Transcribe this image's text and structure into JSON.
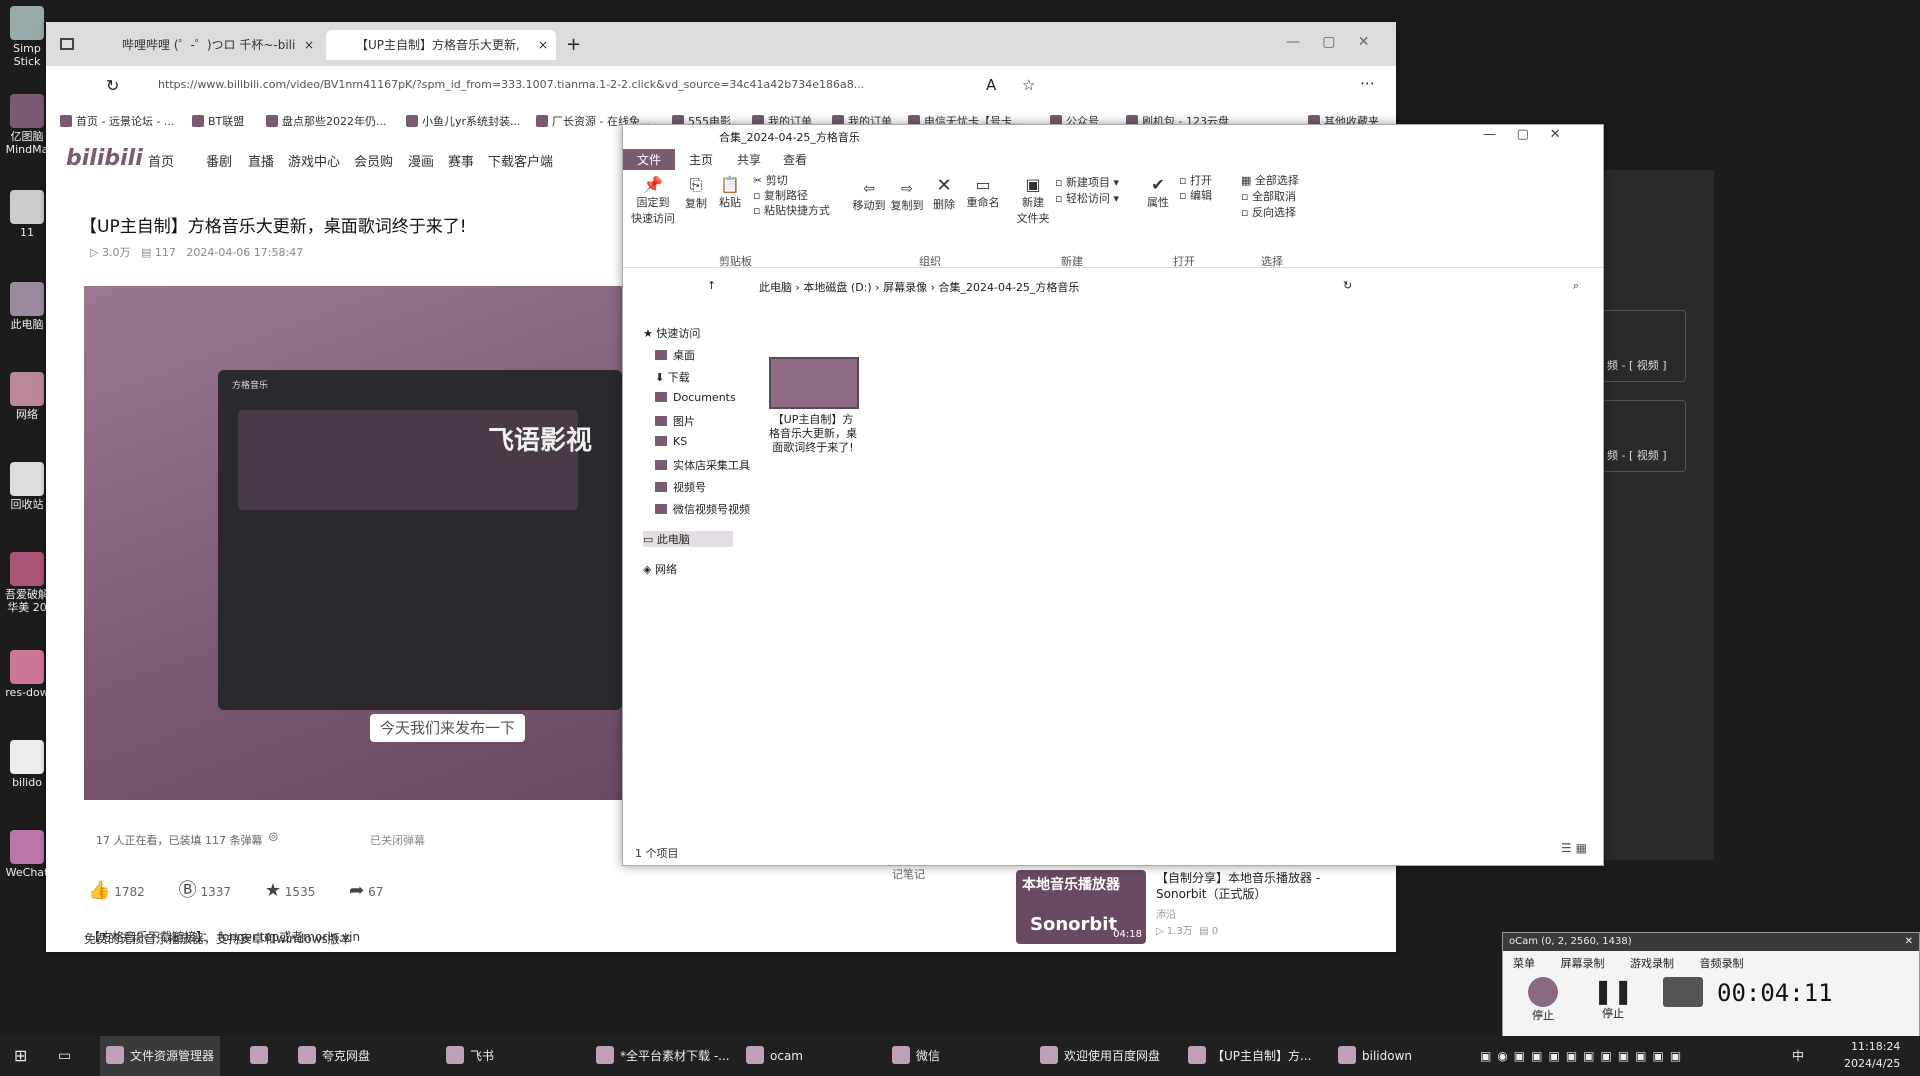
{
  "desktop": {
    "icons": [
      "Simp Stick",
      "亿图脑 MindMa",
      "11",
      "此电脑",
      "网络",
      "回收站",
      "吾爱破解 华美 20",
      "res-dow",
      "bilido",
      "WeChat"
    ]
  },
  "browser": {
    "tabs": [
      {
        "label": "哔哩哔哩 (゜-゜)つロ 千杯~-bili"
      },
      {
        "label": "【UP主自制】方格音乐大更新,"
      }
    ],
    "new_tab": "+",
    "address": "https://www.bilibili.com/video/BV1nm41167pK/?spm_id_from=333.1007.tianma.1-2-2.click&vd_source=34c41a42b734e186a8...",
    "favorites": [
      "首页 - 远景论坛 - ...",
      "BT联盟",
      "盘点那些2022年仍...",
      "小鱼儿yr系统封装...",
      "厂长资源 - 在线免...",
      "555电影",
      "我的订单",
      "我的订单",
      "电信无忧卡【号卡...",
      "公众号",
      "刷机包 - 123云盘",
      "其他收藏夹"
    ]
  },
  "bili": {
    "logo": "bilibili",
    "nav": [
      "首页",
      "番剧",
      "直播",
      "游戏中心",
      "会员购",
      "漫画",
      "赛事",
      "下载客户端"
    ],
    "video_title": "【UP主自制】方格音乐大更新，桌面歌词终于来了!",
    "views": "3.0万",
    "danmaku_count": "117",
    "publish_time": "2024-04-06 17:58:47",
    "player": {
      "app_name": "方格音乐",
      "banner": "飞语影视",
      "subtitle": "今天我们来发布一下"
    },
    "viewer_status": "17 人正在看，已装填 117 条弹幕",
    "danmaku_off": "已关闭弹幕",
    "likes": "1782",
    "coins": "1337",
    "favorites": "1535",
    "shares": "67",
    "desc_line1": "【方格音乐下载链接】：  fonger.top或者morin.vin",
    "desc_line2": "免费的无损音乐播放器，支持安卓和windows版本",
    "rec_title": "【自制分享】本地音乐播放器 - Sonorbit（正式版）",
    "rec_thumb_text": "本地音乐播放器",
    "rec_thumb_brand": "Sonorbit",
    "rec_duration": "04:18",
    "rec_views": "1.3万",
    "rec_comments": "0",
    "rec_up": "添沿",
    "notes_label": "记笔记"
  },
  "explorer": {
    "title": "合集_2024-04-25_方格音乐",
    "tabs": [
      "文件",
      "主页",
      "共享",
      "查看"
    ],
    "ribbon": {
      "pin": "固定到\n快速访问",
      "copy": "复制",
      "paste": "粘贴",
      "cut": "剪切",
      "copy_path": "复制路径",
      "paste_shortcut": "粘贴快捷方式",
      "move_to": "移动到",
      "copy_to": "复制到",
      "delete": "删除",
      "rename": "重命名",
      "new_folder": "新建\n文件夹",
      "new_item": "新建项目",
      "easy_access": "轻松访问",
      "properties": "属性",
      "open": "打开",
      "edit": "编辑",
      "select_all": "全部选择",
      "select_none": "全部取消",
      "invert": "反向选择",
      "groups": [
        "剪贴板",
        "组织",
        "新建",
        "打开",
        "选择"
      ]
    },
    "breadcrumb": [
      "此电脑",
      "本地磁盘 (D:)",
      "屏幕录像",
      "合集_2024-04-25_方格音乐"
    ],
    "tree": [
      "快速访问",
      "桌面",
      "下载",
      "Documents",
      "图片",
      "KS",
      "实体店采集工具",
      "视频号",
      "微信视频号视频",
      "此电脑",
      "网络"
    ],
    "file_name": "【UP主自制】方格音乐大更新，桌面歌词终于来了!",
    "status": "1 个项目"
  },
  "side_panel": {
    "items": [
      "频 - [ 视频 ]",
      "频 - [ 视频 ]"
    ]
  },
  "ocam": {
    "title": "oCam (0, 2, 2560, 1438)",
    "menu": [
      "菜单",
      "屏幕录制",
      "游戏录制",
      "音频录制"
    ],
    "stop": "停止",
    "pause": "停止",
    "timer": "00:04:11"
  },
  "taskbar": {
    "items": [
      "文件资源管理器",
      "夸克网盘",
      "飞书",
      "*全平台素材下载 -...",
      "ocam",
      "微信",
      "欢迎使用百度网盘",
      "【UP主自制】方...",
      "bilidown"
    ],
    "time": "11:18:24",
    "date": "2024/4/25",
    "lang": "中"
  }
}
